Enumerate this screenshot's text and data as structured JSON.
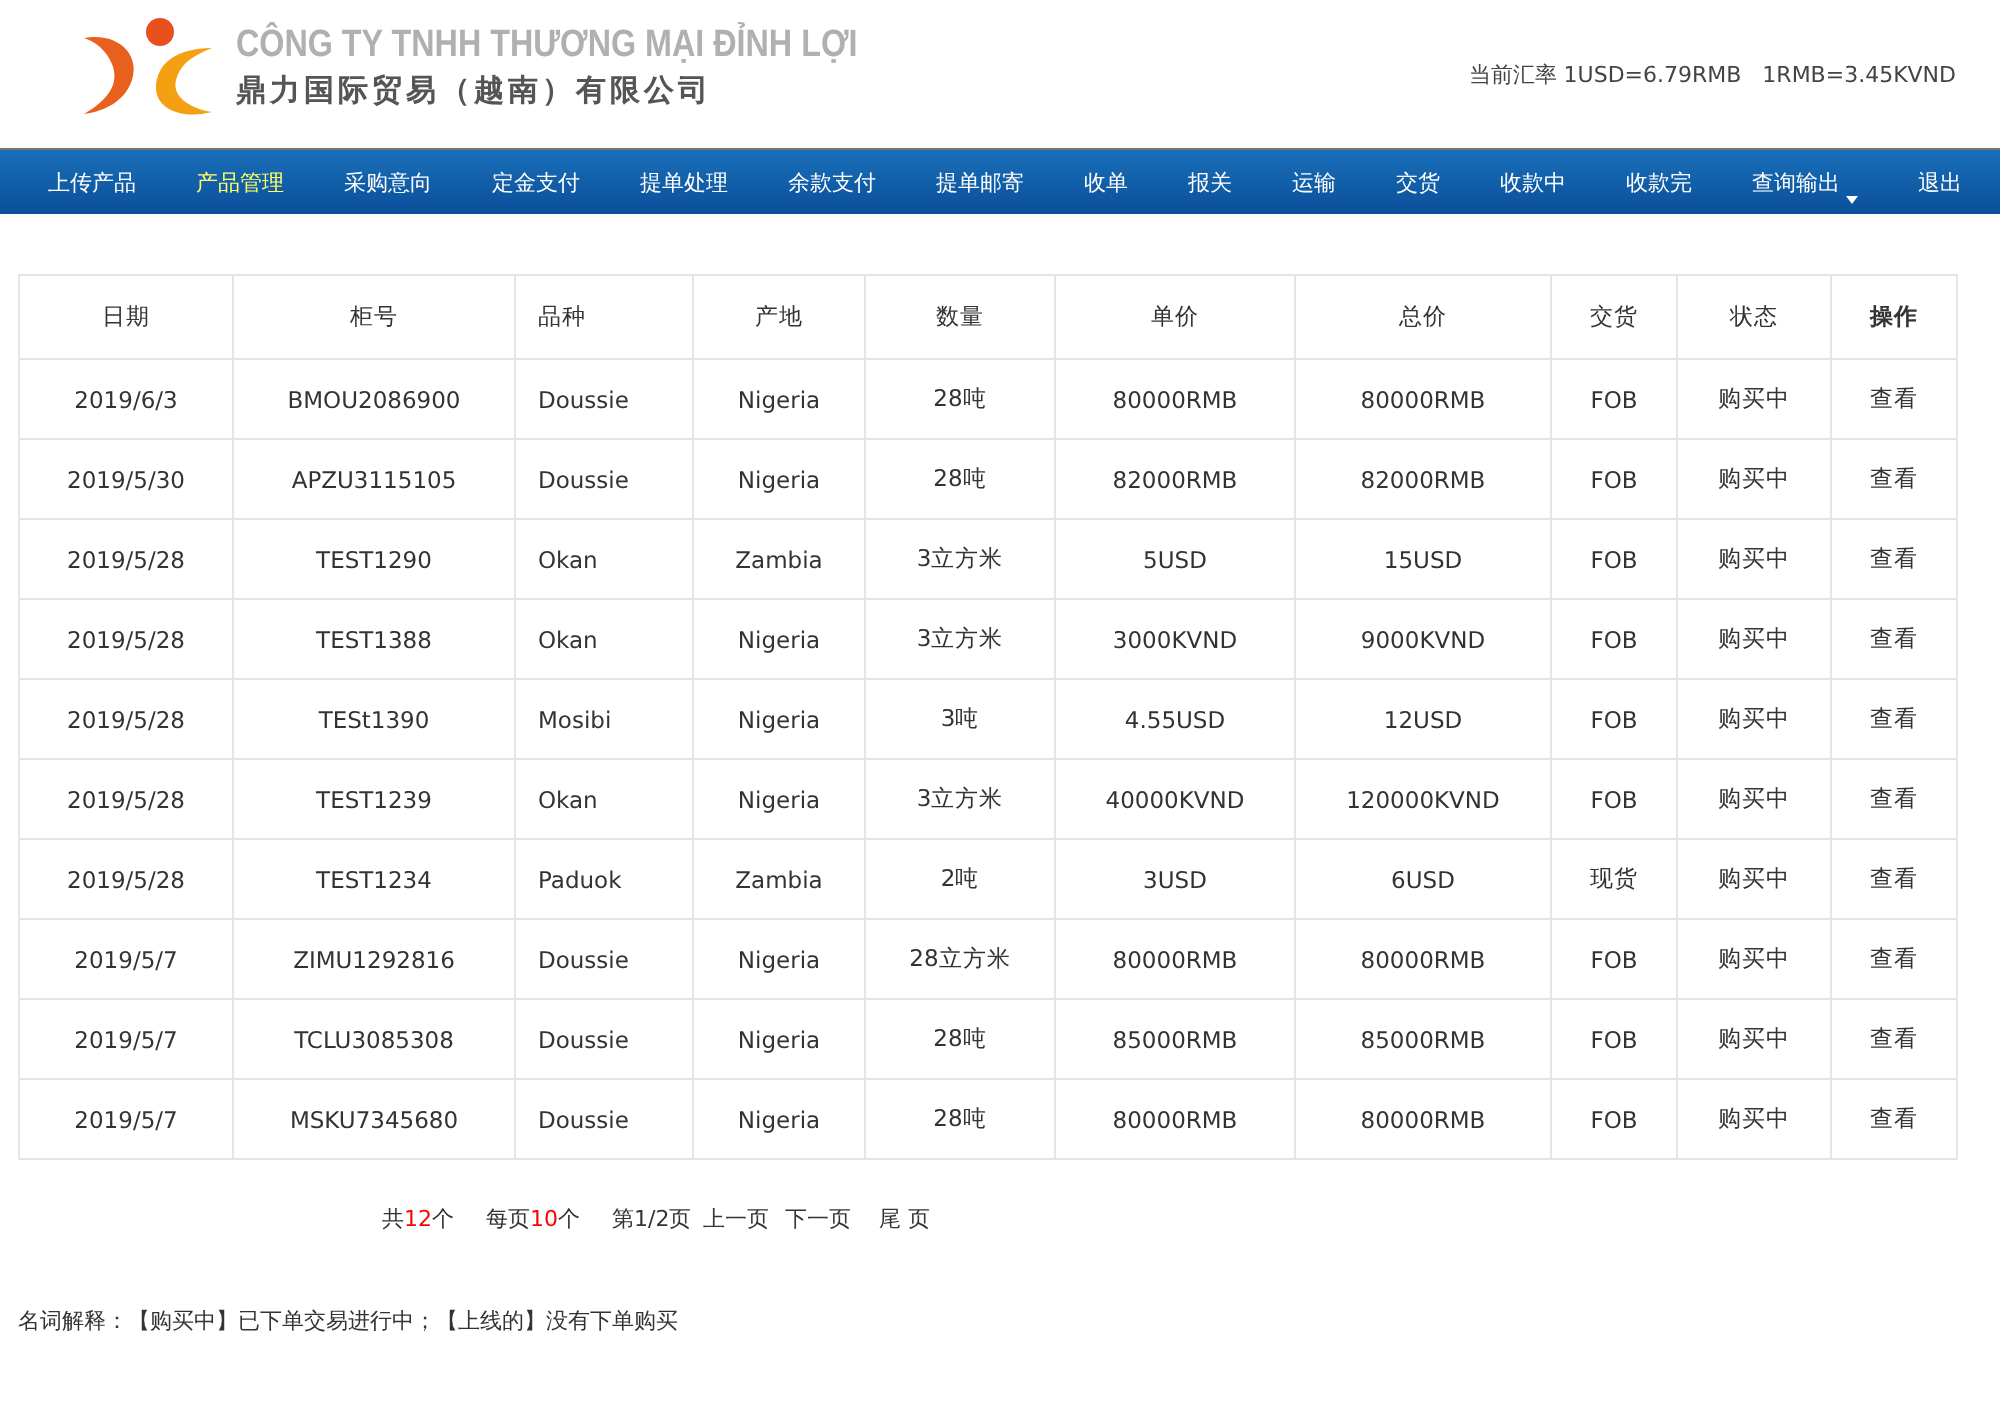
{
  "header": {
    "company_vi": "CÔNG TY TNHH THƯƠNG MẠI ĐỈNH LỢI",
    "company_zh": "鼎力国际贸易（越南）有限公司",
    "exchange_rate": "当前汇率 1USD=6.79RMB   1RMB=3.45KVND"
  },
  "nav": [
    {
      "label": "上传产品",
      "selected": false,
      "dropdown": false
    },
    {
      "label": "产品管理",
      "selected": true,
      "dropdown": false
    },
    {
      "label": "采购意向",
      "selected": false,
      "dropdown": false
    },
    {
      "label": "定金支付",
      "selected": false,
      "dropdown": false
    },
    {
      "label": "提单处理",
      "selected": false,
      "dropdown": false
    },
    {
      "label": "余款支付",
      "selected": false,
      "dropdown": false
    },
    {
      "label": "提单邮寄",
      "selected": false,
      "dropdown": false
    },
    {
      "label": "收单",
      "selected": false,
      "dropdown": false
    },
    {
      "label": "报关",
      "selected": false,
      "dropdown": false
    },
    {
      "label": "运输",
      "selected": false,
      "dropdown": false
    },
    {
      "label": "交货",
      "selected": false,
      "dropdown": false
    },
    {
      "label": "收款中",
      "selected": false,
      "dropdown": false
    },
    {
      "label": "收款完",
      "selected": false,
      "dropdown": false
    },
    {
      "label": "查询输出",
      "selected": false,
      "dropdown": true
    },
    {
      "label": "退出",
      "selected": false,
      "dropdown": false
    }
  ],
  "table": {
    "columns": [
      "日期",
      "柜号",
      "品种",
      "产地",
      "数量",
      "单价",
      "总价",
      "交货",
      "状态",
      "操作"
    ],
    "rows": [
      [
        "2019/6/3",
        "BMOU2086900",
        "Doussie",
        "Nigeria",
        "28吨",
        "80000RMB",
        "80000RMB",
        "FOB",
        "购买中",
        "查看"
      ],
      [
        "2019/5/30",
        "APZU3115105",
        "Doussie",
        "Nigeria",
        "28吨",
        "82000RMB",
        "82000RMB",
        "FOB",
        "购买中",
        "查看"
      ],
      [
        "2019/5/28",
        "TEST1290",
        "Okan",
        "Zambia",
        "3立方米",
        "5USD",
        "15USD",
        "FOB",
        "购买中",
        "查看"
      ],
      [
        "2019/5/28",
        "TEST1388",
        "Okan",
        "Nigeria",
        "3立方米",
        "3000KVND",
        "9000KVND",
        "FOB",
        "购买中",
        "查看"
      ],
      [
        "2019/5/28",
        "TESt1390",
        "Mosibi",
        "Nigeria",
        "3吨",
        "4.55USD",
        "12USD",
        "FOB",
        "购买中",
        "查看"
      ],
      [
        "2019/5/28",
        "TEST1239",
        "Okan",
        "Nigeria",
        "3立方米",
        "40000KVND",
        "120000KVND",
        "FOB",
        "购买中",
        "查看"
      ],
      [
        "2019/5/28",
        "TEST1234",
        "Paduok",
        "Zambia",
        "2吨",
        "3USD",
        "6USD",
        "现货",
        "购买中",
        "查看"
      ],
      [
        "2019/5/7",
        "ZIMU1292816",
        "Doussie",
        "Nigeria",
        "28立方米",
        "80000RMB",
        "80000RMB",
        "FOB",
        "购买中",
        "查看"
      ],
      [
        "2019/5/7",
        "TCLU3085308",
        "Doussie",
        "Nigeria",
        "28吨",
        "85000RMB",
        "85000RMB",
        "FOB",
        "购买中",
        "查看"
      ],
      [
        "2019/5/7",
        "MSKU7345680",
        "Doussie",
        "Nigeria",
        "28吨",
        "80000RMB",
        "80000RMB",
        "FOB",
        "购买中",
        "查看"
      ]
    ]
  },
  "pagination": {
    "total": {
      "before": "共",
      "count": "12",
      "after": "个"
    },
    "per_page": {
      "before": "每页",
      "count": "10",
      "after": "个"
    },
    "page": "第1/2页",
    "prev": "上一页",
    "next": "下一页",
    "last": "尾 页"
  },
  "legend": "名词解释：【购买中】已下单交易进行中；【上线的】没有下单购买"
}
